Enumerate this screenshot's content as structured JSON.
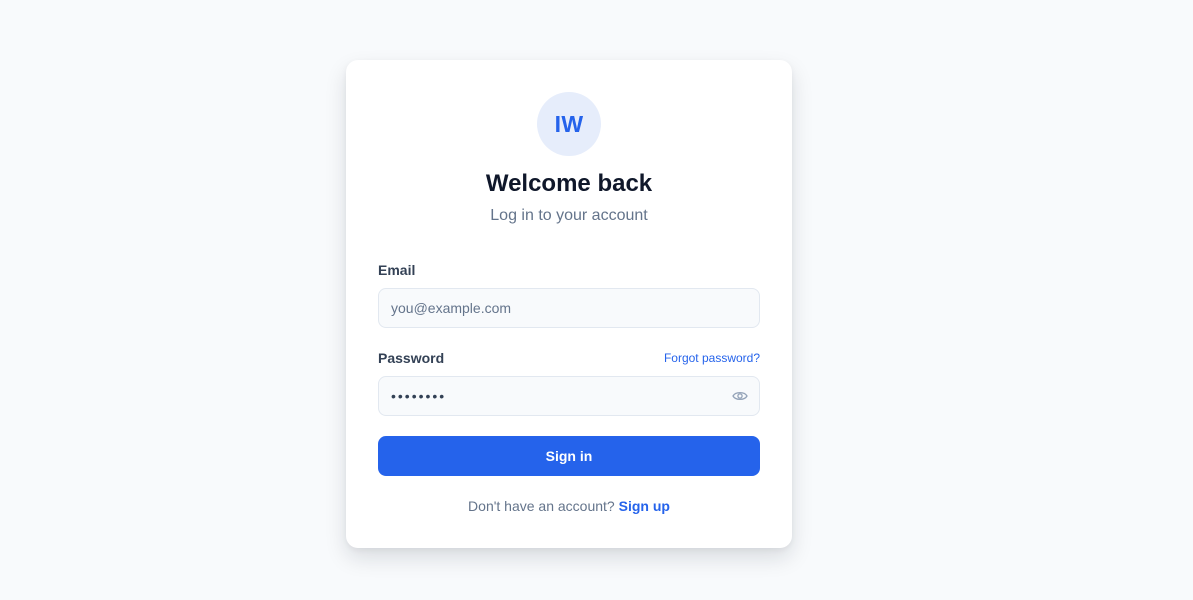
{
  "brand": {
    "avatar_initials": "IW",
    "accent_color": "#2563eb"
  },
  "header": {
    "title": "Welcome back",
    "subtitle": "Log in to your account"
  },
  "form": {
    "email": {
      "label": "Email",
      "placeholder": "you@example.com",
      "value": ""
    },
    "password": {
      "label": "Password",
      "value": "password",
      "forgot_label": "Forgot password?",
      "toggle_icon": "eye-icon"
    },
    "submit_label": "Sign in"
  },
  "footer": {
    "prompt": "Don't have an account?",
    "signup_label": "Sign up"
  }
}
